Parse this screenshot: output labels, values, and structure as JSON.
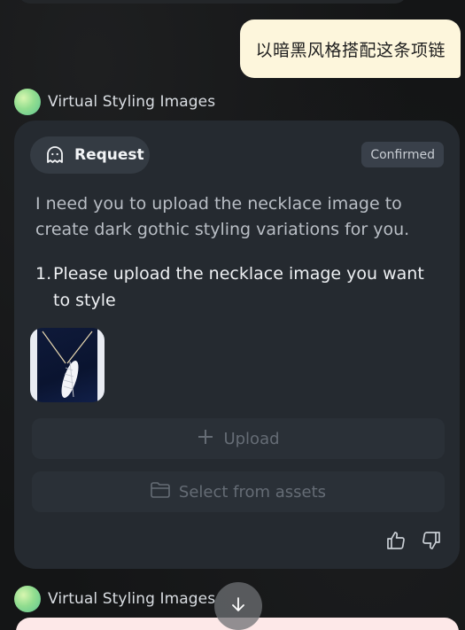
{
  "user_message": "以暗黑风格搭配这条项链",
  "agent": {
    "name": "Virtual Styling Images"
  },
  "request_card": {
    "pill_label": "Request",
    "status_badge": "Confirmed",
    "intro_text": "I need you to upload the necklace image to create dark gothic styling variations for you.",
    "steps": [
      {
        "number": "1.",
        "text": "Please upload the necklace image you want to style"
      }
    ],
    "upload_label": "Upload",
    "select_assets_label": "Select from assets"
  },
  "second_agent": {
    "name": "Virtual Styling Images"
  },
  "icons": {
    "request": "ghost-icon",
    "upload": "plus-icon",
    "select_assets": "folder-icon",
    "like": "thumbs-up-icon",
    "dislike": "thumbs-down-icon",
    "scroll": "arrow-down-icon"
  },
  "colors": {
    "user_bubble": "#fdf6dc",
    "card": "#252a30",
    "avatar_gradient": [
      "#d8f6b0",
      "#5fc592"
    ]
  }
}
